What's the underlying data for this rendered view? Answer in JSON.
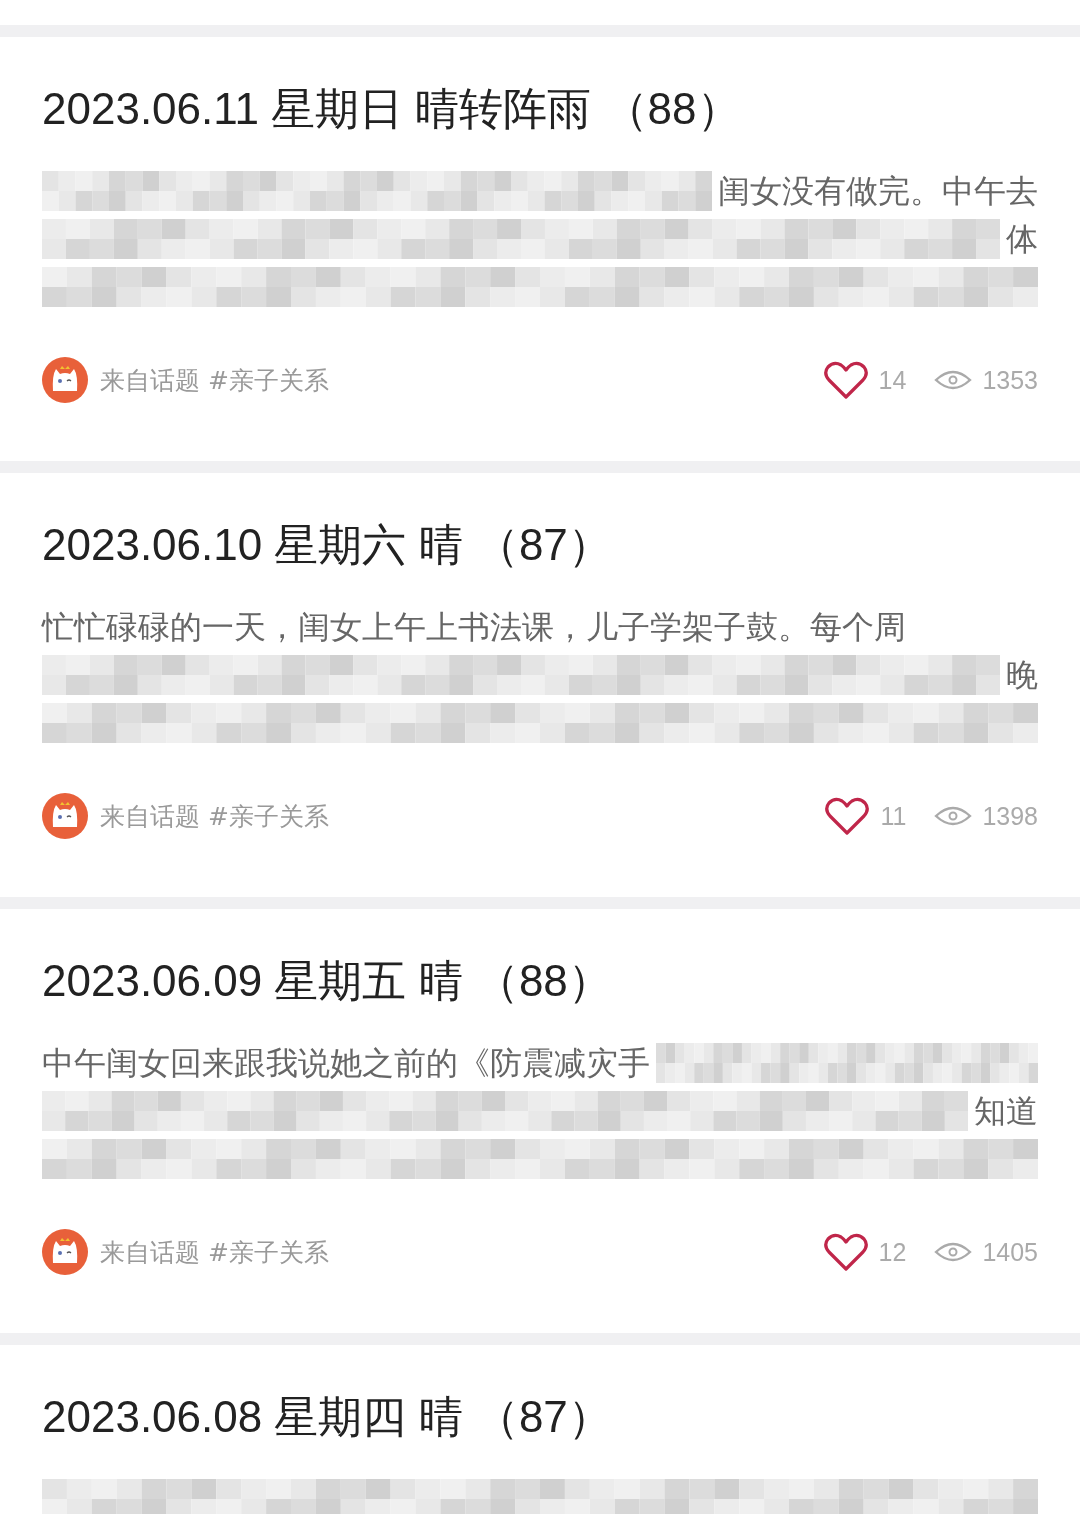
{
  "posts": [
    {
      "title": "2023.06.11 星期日 晴转阵雨 （88）",
      "lines": [
        [
          {
            "kind": "blur"
          },
          {
            "kind": "text",
            "text": "闺女没有做完。中午去"
          }
        ],
        [
          {
            "kind": "blur"
          },
          {
            "kind": "text",
            "text": "体"
          }
        ],
        [
          {
            "kind": "blur"
          }
        ]
      ],
      "topic": "来自话题 #亲子关系",
      "likes": "14",
      "views": "1353"
    },
    {
      "title": "2023.06.10 星期六 晴 （87）",
      "lines": [
        [
          {
            "kind": "text",
            "text": "忙忙碌碌的一天，闺女上午上书法课，儿子学架子鼓。每个周"
          }
        ],
        [
          {
            "kind": "blur"
          },
          {
            "kind": "text",
            "text": "晚"
          }
        ],
        [
          {
            "kind": "blur"
          }
        ]
      ],
      "topic": "来自话题 #亲子关系",
      "likes": "11",
      "views": "1398"
    },
    {
      "title": "2023.06.09 星期五 晴 （88）",
      "lines": [
        [
          {
            "kind": "text",
            "text": "中午闺女回来跟我说她之前的《防震减灾手"
          },
          {
            "kind": "blur"
          }
        ],
        [
          {
            "kind": "blur"
          },
          {
            "kind": "text",
            "text": "知道"
          }
        ],
        [
          {
            "kind": "blur"
          }
        ]
      ],
      "topic": "来自话题 #亲子关系",
      "likes": "12",
      "views": "1405"
    },
    {
      "title": "2023.06.08 星期四 晴 （87）",
      "lines": [
        [
          {
            "kind": "blur"
          }
        ]
      ]
    }
  ]
}
